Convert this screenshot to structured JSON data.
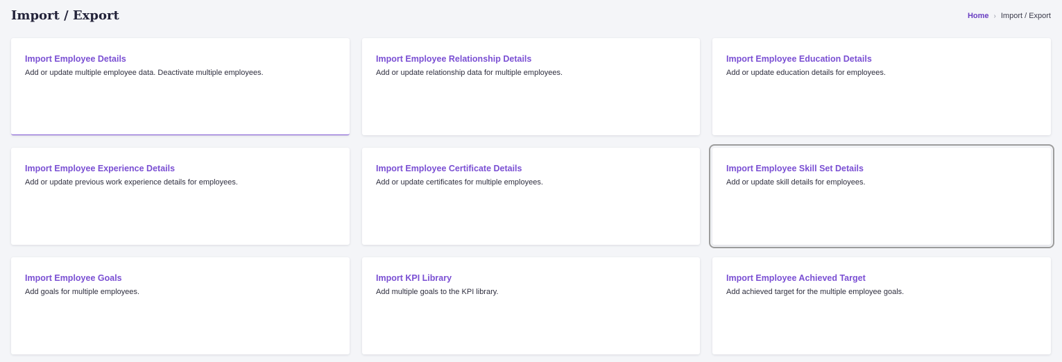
{
  "header": {
    "title": "Import / Export"
  },
  "breadcrumb": {
    "home": "Home",
    "separator": "›",
    "current": "Import / Export"
  },
  "cards": [
    {
      "title": "Import Employee Details",
      "description": "Add or update multiple employee data. Deactivate multiple employees."
    },
    {
      "title": "Import Employee Relationship Details",
      "description": "Add or update relationship data for multiple employees."
    },
    {
      "title": "Import Employee Education Details",
      "description": "Add or update education details for employees."
    },
    {
      "title": "Import Employee Experience Details",
      "description": "Add or update previous work experience details for employees."
    },
    {
      "title": "Import Employee Certificate Details",
      "description": "Add or update certificates for multiple employees."
    },
    {
      "title": "Import Employee Skill Set Details",
      "description": "Add or update skill details for employees."
    },
    {
      "title": "Import Employee Goals",
      "description": "Add goals for multiple employees."
    },
    {
      "title": "Import KPI Library",
      "description": "Add multiple goals to the KPI library."
    },
    {
      "title": "Import Employee Achieved Target",
      "description": "Add achieved target for the multiple employee goals."
    }
  ],
  "colors": {
    "accent": "#7a4fd3",
    "page_background": "#f4f5f8",
    "card_background": "#ffffff",
    "focus_outline": "#9c9c9c"
  }
}
